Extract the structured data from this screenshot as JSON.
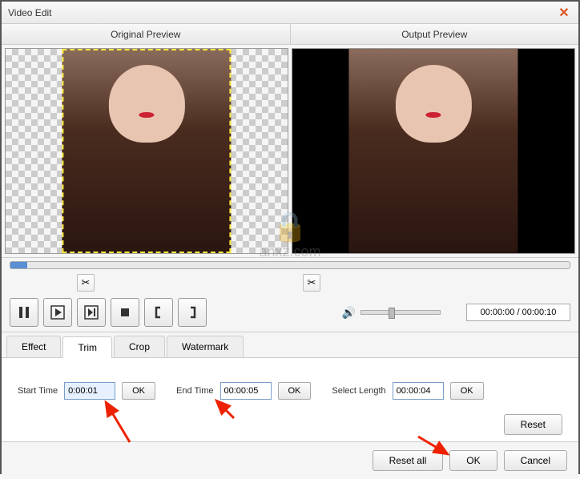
{
  "title": "Video Edit",
  "previews": {
    "original": "Original Preview",
    "output": "Output Preview"
  },
  "watermark_text": "anxz.com",
  "time_display": "00:00:00 / 00:00:10",
  "tabs": {
    "effect": "Effect",
    "trim": "Trim",
    "crop": "Crop",
    "watermark": "Watermark"
  },
  "trim": {
    "start_label": "Start Time",
    "start_value": "0:00:01",
    "end_label": "End Time",
    "end_value": "00:00:05",
    "length_label": "Select Length",
    "length_value": "00:00:04",
    "ok": "OK",
    "reset": "Reset"
  },
  "buttons": {
    "reset_all": "Reset all",
    "ok": "OK",
    "cancel": "Cancel"
  }
}
